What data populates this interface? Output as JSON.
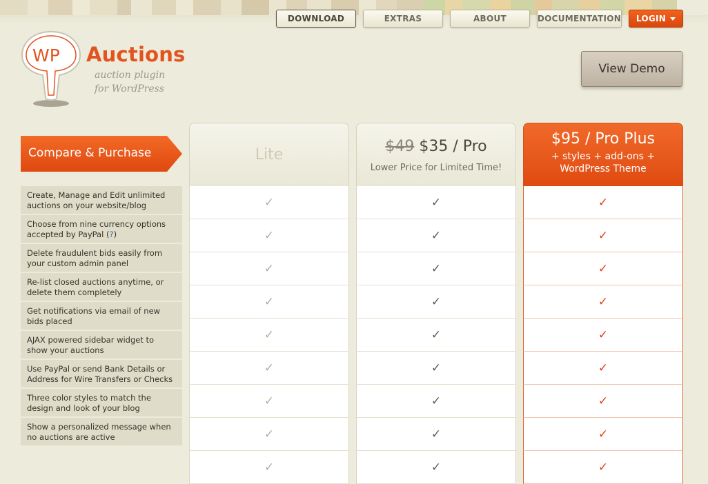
{
  "nav": {
    "download": "DOWNLOAD",
    "extras": "EXTRAS",
    "about": "ABOUT",
    "documentation": "DOCUMENTATION",
    "login": "LOGIN"
  },
  "logo": {
    "wp": "WP",
    "title": "Auctions",
    "tagline_1": "auction plugin",
    "tagline_2": "for WordPress"
  },
  "view_demo": "View Demo",
  "compare_label": "Compare & Purchase",
  "plans": {
    "lite": {
      "title": "Lite"
    },
    "pro": {
      "old_price": "$49",
      "title": "$35 / Pro",
      "subtitle": "Lower Price for Limited Time!"
    },
    "plus": {
      "title": "$95 / Pro Plus",
      "sub_1": "+ styles + add-ons +",
      "sub_2": "WordPress Theme"
    }
  },
  "features": [
    {
      "text": "Create, Manage and Edit unlimited auctions on your website/blog"
    },
    {
      "text": "Choose from nine currency options accepted by PayPal (",
      "q": "?",
      "tail": ")"
    },
    {
      "text": "Delete fraudulent bids easily from your custom admin panel"
    },
    {
      "text": "Re-list closed auctions anytime, or delete them completely"
    },
    {
      "text": "Get notifications via email of new bids placed"
    },
    {
      "text": "AJAX powered sidebar widget to show your auctions"
    },
    {
      "text": "Use PayPal or send Bank Details or Address for Wire Transfers or Checks"
    },
    {
      "text": "Three color styles to match the design and look of your blog"
    },
    {
      "text": "Show a personalized message when no auctions are active"
    }
  ],
  "check_glyph": "✓",
  "colors": {
    "accent": "#e2531d",
    "login": "#e5520f",
    "plus_header": "#e85a1a",
    "check_plus": "#e2401a"
  }
}
